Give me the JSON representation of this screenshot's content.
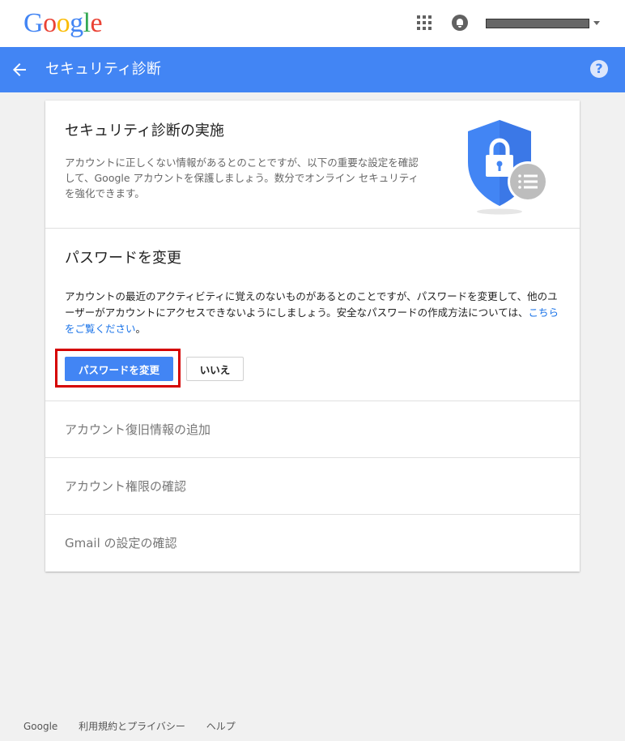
{
  "brand": {
    "letters": [
      "G",
      "o",
      "o",
      "g",
      "l",
      "e"
    ]
  },
  "header": {
    "icons": [
      "apps-grid-icon",
      "notifications-icon",
      "account-menu-caret-icon"
    ]
  },
  "appbar": {
    "title": "セキュリティ診断",
    "back_icon": "arrow-back-icon",
    "help_icon": "help-icon",
    "help_glyph": "?"
  },
  "intro": {
    "title": "セキュリティ診断の実施",
    "description": "アカウントに正しくない情報があるとのことですが、以下の重要な設定を確認して、Google アカウントを保護しましょう。数分でオンライン セキュリティを強化できます。",
    "illustration": "shield-lock-checklist-icon"
  },
  "password": {
    "title": "パスワードを変更",
    "description": "アカウントの最近のアクティビティに覚えのないものがあるとのことですが、パスワードを変更して、他のユーザーがアカウントにアクセスできないようにしましょう。安全なパスワードの作成方法については、",
    "link_text": "こちらをご覧ください",
    "description_end": "。",
    "change_button": "パスワードを変更",
    "no_button": "いいえ"
  },
  "sections": {
    "recovery": "アカウント復旧情報の追加",
    "permissions": "アカウント権限の確認",
    "gmail": "Gmail の設定の確認"
  },
  "footer": {
    "google": "Google",
    "terms": "利用規約とプライバシー",
    "help": "ヘルプ"
  },
  "colors": {
    "brand_blue": "#4285f4",
    "highlight_red": "#d50000",
    "link_blue": "#1a73e8"
  }
}
